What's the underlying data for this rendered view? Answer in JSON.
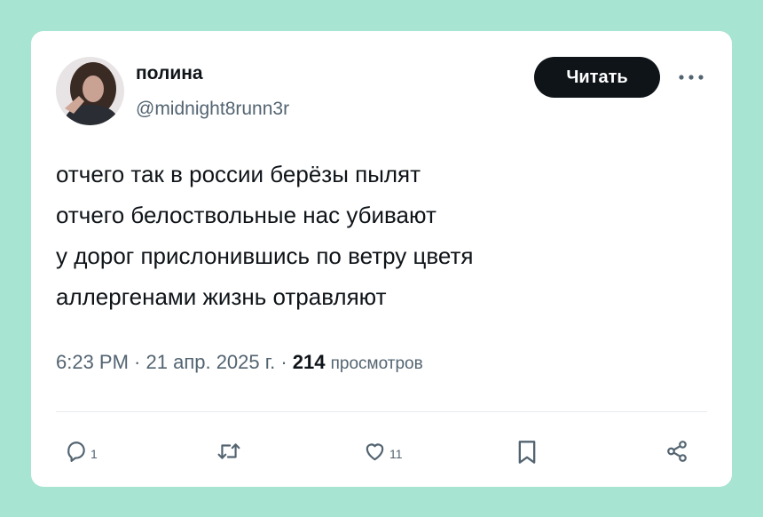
{
  "author": {
    "name": "полина",
    "handle": "@midnight8runn3r"
  },
  "follow_button": {
    "label": "Читать"
  },
  "tweet": {
    "lines": [
      "отчего так в россии берёзы пылят",
      "отчего белоствольные нас убивают",
      "у дорог прислонившись по ветру цветя",
      "аллергенами жизнь отравляют"
    ]
  },
  "meta": {
    "time": "6:23 PM",
    "separator": " · ",
    "date": "21 апр. 2025 г.",
    "views_count": "214",
    "views_label": "просмотров"
  },
  "actions": {
    "reply_count": "1",
    "like_count": "11"
  },
  "icons": {
    "avatar": "profile-photo",
    "more": "more-dots-icon",
    "reply": "reply-icon",
    "retweet": "retweet-icon",
    "like": "heart-icon",
    "bookmark": "bookmark-icon",
    "share": "share-icon"
  },
  "colors": {
    "background": "#a8e4d2",
    "card": "#ffffff",
    "text": "#0f1419",
    "secondary": "#536471"
  }
}
